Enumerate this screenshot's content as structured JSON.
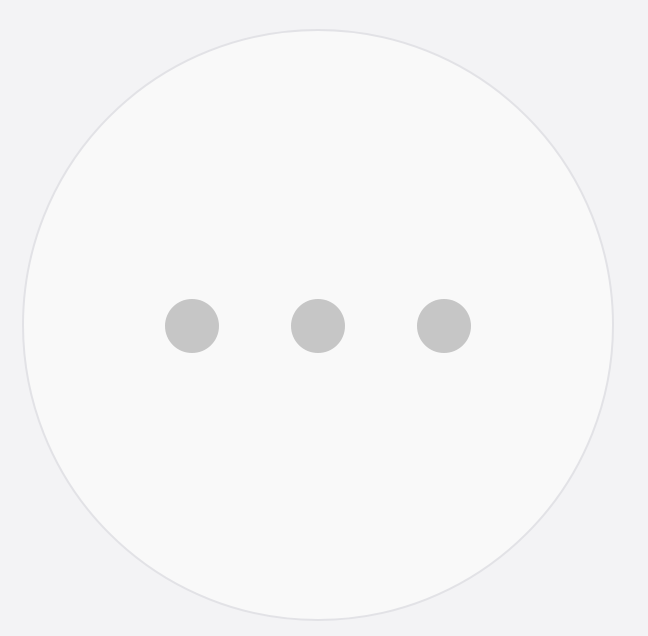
{
  "button": {
    "icon": "more-horizontal-icon",
    "aria_label": "More options",
    "colors": {
      "page_background": "#f3f3f5",
      "circle_fill": "#f9f9f9",
      "circle_border": "#e2e2e6",
      "dot_fill": "#c6c6c6"
    }
  }
}
